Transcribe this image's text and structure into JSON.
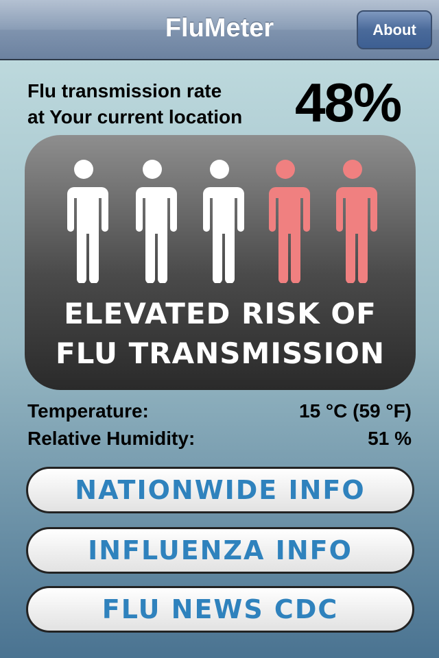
{
  "nav": {
    "title": "FluMeter",
    "about_label": "About"
  },
  "rate": {
    "label_line1": "Flu transmission rate",
    "label_line2": "at Your current location",
    "value": "48%"
  },
  "risk": {
    "figures_total": 5,
    "figures_affected": 2,
    "affected_color": "#f08080",
    "normal_color": "#ffffff",
    "line1": "ELEVATED RISK OF",
    "line2": "FLU TRANSMISSION"
  },
  "conditions": [
    {
      "label": "Temperature:",
      "value": "15 °C (59 °F)"
    },
    {
      "label": "Relative Humidity:",
      "value": "51 %"
    }
  ],
  "buttons": [
    {
      "label": "NATIONWIDE INFO"
    },
    {
      "label": "INFLUENZA INFO"
    },
    {
      "label": "FLU NEWS CDC"
    }
  ]
}
